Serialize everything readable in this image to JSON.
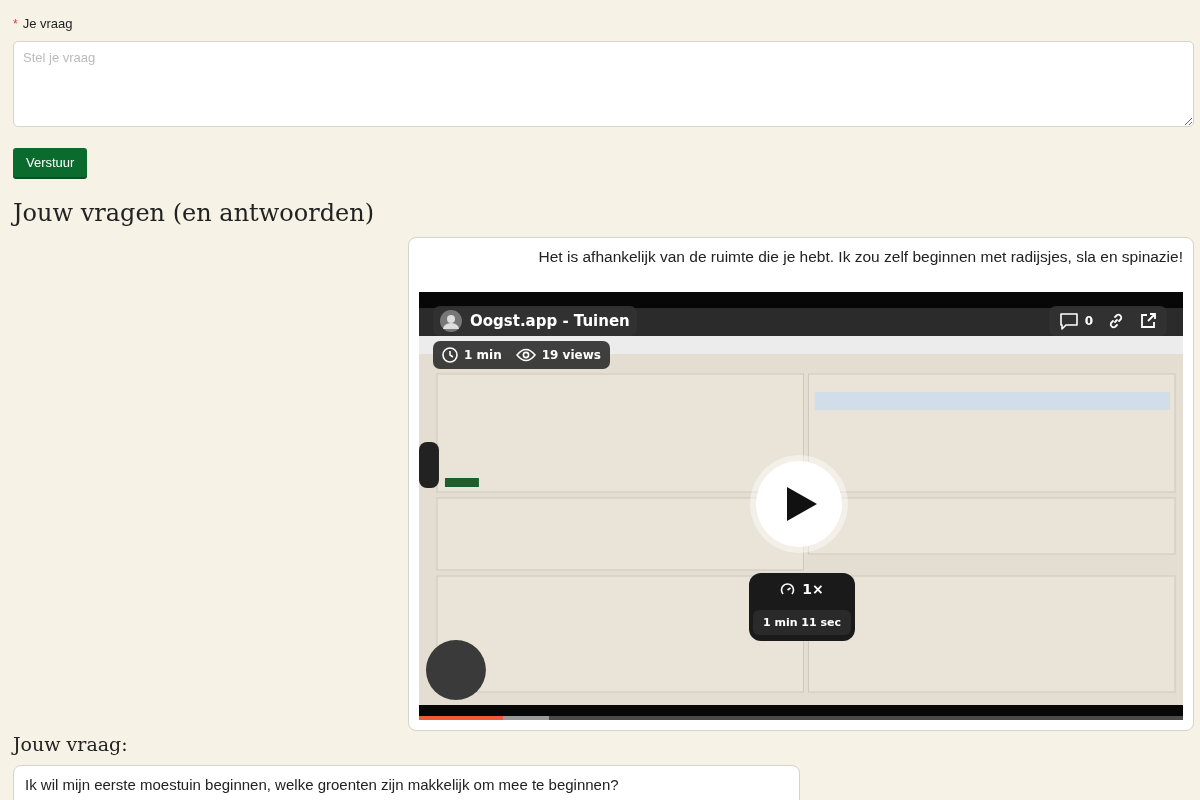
{
  "question_form": {
    "label": "Je vraag",
    "required_mark": "*",
    "placeholder": "Stel je vraag",
    "submit": "Verstuur"
  },
  "questions_heading": "Jouw vragen (en antwoorden)",
  "answer": {
    "text": "Het is afhankelijk van de ruimte die je hebt. Ik zou zelf beginnen met radijsjes, sla en spinazie!",
    "video": {
      "kind": "picture",
      "title": "Oogst.app - Tuinen",
      "comments": "0",
      "duration": "1 min",
      "views": "19 views",
      "speed": "1×",
      "length": "1 min 11 sec",
      "progress": {
        "level": 0.11
      }
    }
  },
  "your_question": {
    "label": "Jouw vraag:",
    "text": "Ik wil mijn eerste moestuin beginnen, welke groenten zijn makkelijk om mee te beginnen?"
  }
}
